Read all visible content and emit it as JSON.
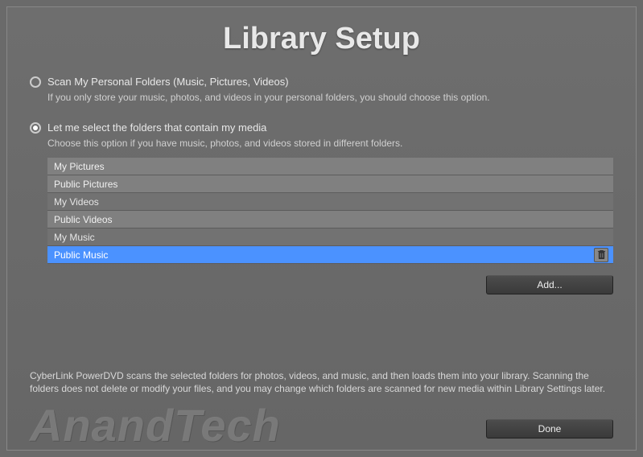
{
  "title": "Library Setup",
  "options": {
    "personal": {
      "label": "Scan My Personal Folders (Music, Pictures, Videos)",
      "help": "If you only store your music, photos, and videos in your personal folders, you should choose this option.",
      "selected": false
    },
    "select": {
      "label": "Let me select the folders that contain my media",
      "help": "Choose this option if you have music, photos, and videos stored in different folders.",
      "selected": true
    }
  },
  "folders": [
    {
      "name": "My Pictures",
      "selected": false
    },
    {
      "name": "Public Pictures",
      "selected": false
    },
    {
      "name": "My Videos",
      "selected": false
    },
    {
      "name": "Public Videos",
      "selected": false
    },
    {
      "name": "My Music",
      "selected": false
    },
    {
      "name": "Public Music",
      "selected": true
    }
  ],
  "buttons": {
    "add": "Add...",
    "done": "Done"
  },
  "info": "CyberLink PowerDVD scans the selected folders for photos, videos, and music, and then loads them into your library. Scanning the folders does not delete or modify your files, and you may change which folders are scanned for new media within Library Settings later.",
  "watermark": "AnandTech"
}
